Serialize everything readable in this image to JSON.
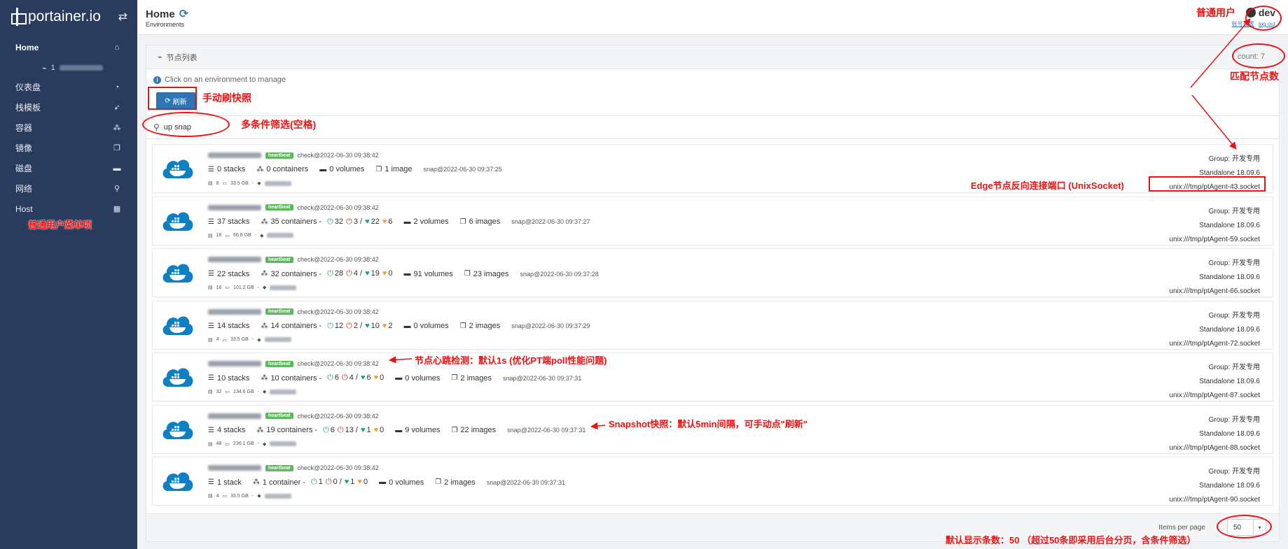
{
  "sidebar": {
    "logo_text": "portainer.io",
    "items": [
      {
        "label": "Home",
        "icon": "home-icon",
        "glyph": "⌂"
      },
      {
        "label": "仪表盘",
        "icon": "dashboard-icon",
        "glyph": "◔"
      },
      {
        "label": "栈模板",
        "icon": "rocket-icon",
        "glyph": "➶"
      },
      {
        "label": "容器",
        "icon": "cubes-icon",
        "glyph": "⁂"
      },
      {
        "label": "镜像",
        "icon": "clone-icon",
        "glyph": "❐"
      },
      {
        "label": "磁盘",
        "icon": "hdd-icon",
        "glyph": "▬"
      },
      {
        "label": "网络",
        "icon": "sitemap-icon",
        "glyph": "⚲"
      },
      {
        "label": "Host",
        "icon": "th-icon",
        "glyph": "▦"
      }
    ],
    "endpoint_prefix": "1"
  },
  "header": {
    "title": "Home",
    "breadcrumb": "Environments",
    "user": "dev",
    "link_account": "账号设置",
    "link_logout": "log out"
  },
  "panel": {
    "title": "节点列表",
    "count": "count: 7",
    "info": "Click on an environment to manage",
    "refresh_label": "刷新",
    "search_value": "up snap",
    "items_per_page_label": "Items per page",
    "items_per_page_value": "50"
  },
  "environments": [
    {
      "check": "check@2022-06-30 09:38:42",
      "stacks": "0 stacks",
      "containers": "0 containers",
      "status": null,
      "volumes": "0 volumes",
      "images": "1 image",
      "snap": "snap@2022-06-30 09:37:25",
      "cpu": "8",
      "mem": "33.5 GB",
      "group": "Group: 开发专用",
      "engine": "Standalone 18.09.6",
      "socket": "unix:///tmp/ptAgent-43.socket"
    },
    {
      "check": "check@2022-06-30 09:38:42",
      "stacks": "37 stacks",
      "containers": "35 containers -",
      "status": {
        "running": "32",
        "stopped": "3 /",
        "healthy": "22",
        "unhealthy": "6"
      },
      "volumes": "2 volumes",
      "images": "6 images",
      "snap": "snap@2022-06-30 09:37:27",
      "cpu": "16",
      "mem": "66.8 GB",
      "group": "Group: 开发专用",
      "engine": "Standalone 18.09.6",
      "socket": "unix:///tmp/ptAgent-59.socket"
    },
    {
      "check": "check@2022-06-30 09:38:42",
      "stacks": "22 stacks",
      "containers": "32 containers -",
      "status": {
        "running": "28",
        "stopped": "4 /",
        "healthy": "19",
        "unhealthy": "0"
      },
      "volumes": "91 volumes",
      "images": "23 images",
      "snap": "snap@2022-06-30 09:37:28",
      "cpu": "16",
      "mem": "101.2 GB",
      "group": "Group: 开发专用",
      "engine": "Standalone 18.09.6",
      "socket": "unix:///tmp/ptAgent-66.socket"
    },
    {
      "check": "check@2022-06-30 09:38:42",
      "stacks": "14 stacks",
      "containers": "14 containers -",
      "status": {
        "running": "12",
        "stopped": "2 /",
        "healthy": "10",
        "unhealthy": "2"
      },
      "volumes": "0 volumes",
      "images": "2 images",
      "snap": "snap@2022-06-30 09:37:29",
      "cpu": "4",
      "mem": "33.5 GB",
      "group": "Group: 开发专用",
      "engine": "Standalone 18.09.6",
      "socket": "unix:///tmp/ptAgent-72.socket"
    },
    {
      "check": "check@2022-06-30 09:38:42",
      "stacks": "10 stacks",
      "containers": "10 containers -",
      "status": {
        "running": "6",
        "stopped": "4 /",
        "healthy": "6",
        "unhealthy": "0"
      },
      "volumes": "0 volumes",
      "images": "2 images",
      "snap": "snap@2022-06-30 09:37:31",
      "cpu": "32",
      "mem": "134.6 GB",
      "group": "Group: 开发专用",
      "engine": "Standalone 18.09.6",
      "socket": "unix:///tmp/ptAgent-87.socket"
    },
    {
      "check": "check@2022-06-30 09:38:42",
      "stacks": "4 stacks",
      "containers": "19 containers -",
      "status": {
        "running": "6",
        "stopped": "13 /",
        "healthy": "1",
        "unhealthy": "0"
      },
      "volumes": "9 volumes",
      "images": "22 images",
      "snap": "snap@2022-06-30 09:37:31",
      "cpu": "48",
      "mem": "236.1 GB",
      "group": "Group: 开发专用",
      "engine": "Standalone 18.09.6",
      "socket": "unix:///tmp/ptAgent-88.socket"
    },
    {
      "check": "check@2022-06-30 09:38:42",
      "stacks": "1 stack",
      "containers": "1 container -",
      "status": {
        "running": "1",
        "stopped": "0 /",
        "healthy": "1",
        "unhealthy": "0"
      },
      "volumes": "0 volumes",
      "images": "2 images",
      "snap": "snap@2022-06-30 09:37:31",
      "cpu": "4",
      "mem": "33.5 GB",
      "group": "Group: 开发专用",
      "engine": "Standalone 18.09.6",
      "socket": "unix:///tmp/ptAgent-90.socket"
    }
  ],
  "heartbeat_label": "heartbeat",
  "annotations": {
    "normal_user": "普通用户",
    "match_count": "匹配节点数",
    "manual_refresh": "手动刷快照",
    "multi_filter": "多条件筛选(空格)",
    "edge_port": "Edge节点反向连接端口 (UnixSocket)",
    "user_menu": "普通用户菜单项",
    "heartbeat": "节点心跳检测：默认1s (优化PT端poll性能问题)",
    "snapshot": "Snapshot快照：默认5min间隔，可手动点\"刷新\"",
    "page_size": "默认显示条数：50 （超过50条即采用后台分页，含条件筛选）"
  },
  "colors": {
    "sidebar": "#2a3c5e",
    "accent": "#337ab7",
    "annotation": "#ee1111",
    "heartbeat": "#5cb85c"
  }
}
